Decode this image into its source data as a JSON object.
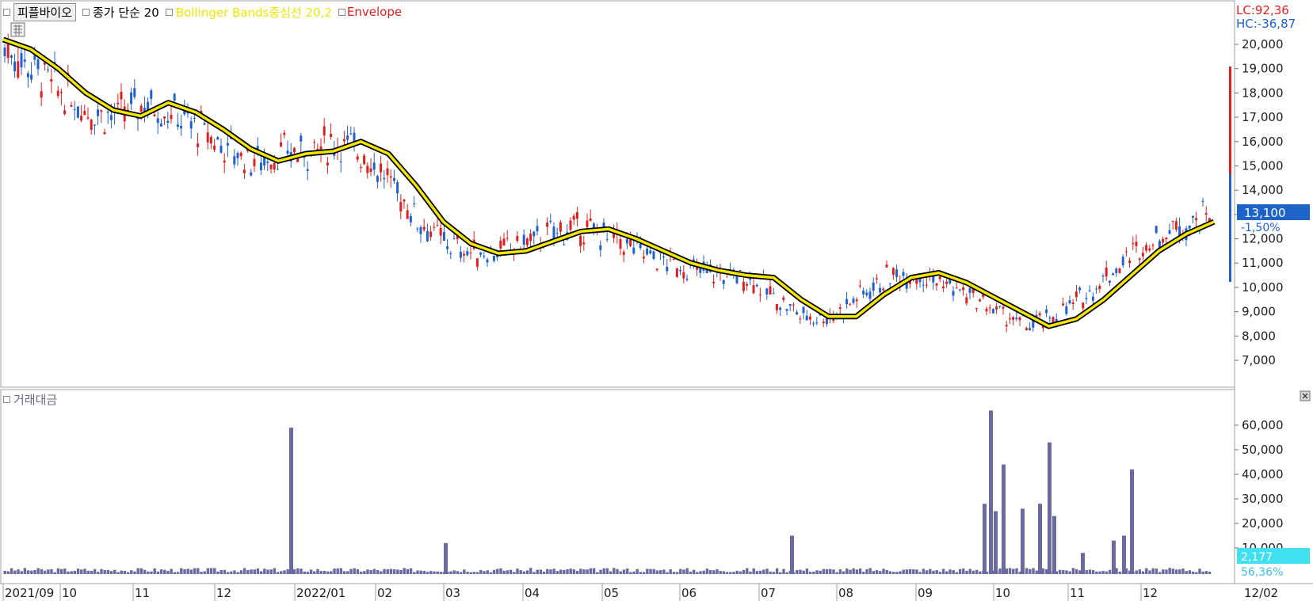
{
  "legend": {
    "stock_name": "피플바이오",
    "ma_label": "종가 단순 20",
    "bb_label": "Bollinger Bands중심선 20,2",
    "env_label": "Envelope"
  },
  "volume_title": "거래대금",
  "top_right": {
    "lc": "LC:92,36",
    "hc": "HC:-36,87"
  },
  "current": {
    "price": "13,100",
    "change": "-1,50%",
    "volume": "2,177",
    "volume_pct": "56,36%"
  },
  "colors": {
    "up": "#e02020",
    "down": "#2060d0",
    "ma": "#000000",
    "bb": "#f2e600",
    "volume": "#6a6aa0",
    "price_box": "#1e64c8",
    "volume_box": "#40e0f0"
  },
  "chart_data": [
    {
      "type": "candlestick",
      "title": "",
      "ylim": [
        6200,
        21200
      ],
      "y_ticks": [
        "7,000",
        "8,000",
        "9,000",
        "10,000",
        "11,000",
        "12,000",
        "13,000",
        "14,000",
        "15,000",
        "16,000",
        "17,000",
        "18,000",
        "19,000",
        "20,000"
      ],
      "x_ticks": [
        "2021/09",
        "10",
        "11",
        "12",
        "2022/01",
        "02",
        "03",
        "04",
        "05",
        "06",
        "07",
        "08",
        "09",
        "10",
        "11",
        "12",
        "12/02"
      ],
      "series": [
        {
          "name": "종가 단순 20",
          "values": [
            20200,
            19800,
            19000,
            18000,
            17300,
            17050,
            17600,
            17200,
            16500,
            15700,
            15200,
            15500,
            15600,
            16000,
            15500,
            14200,
            12700,
            11800,
            11400,
            11500,
            11900,
            12300,
            12400,
            12000,
            11500,
            11000,
            10700,
            10500,
            10400,
            9500,
            8800,
            8800,
            9700,
            10400,
            10600,
            10200,
            9600,
            9000,
            8400,
            8700,
            9500,
            10500,
            11500,
            12200,
            12700
          ]
        },
        {
          "name": "Bollinger Bands중심선 20,2",
          "values": [
            20200,
            19800,
            19000,
            18000,
            17300,
            17050,
            17600,
            17200,
            16500,
            15700,
            15200,
            15500,
            15600,
            16000,
            15500,
            14200,
            12700,
            11800,
            11400,
            11500,
            11900,
            12300,
            12400,
            12000,
            11500,
            11000,
            10700,
            10500,
            10400,
            9500,
            8800,
            8800,
            9700,
            10400,
            10600,
            10200,
            9600,
            9000,
            8400,
            8700,
            9500,
            10500,
            11500,
            12200,
            12700
          ]
        }
      ],
      "last_close": 13100
    },
    {
      "type": "bar",
      "title": "거래대금",
      "ylim": [
        0,
        70000
      ],
      "y_ticks": [
        "10,000",
        "20,000",
        "30,000",
        "40,000",
        "50,000",
        "60,000"
      ],
      "spikes": [
        {
          "x": 367,
          "value": 59000
        },
        {
          "x": 562,
          "value": 12000
        },
        {
          "x": 999,
          "value": 15000
        },
        {
          "x": 1242,
          "value": 28000
        },
        {
          "x": 1250,
          "value": 66000
        },
        {
          "x": 1256,
          "value": 25000
        },
        {
          "x": 1266,
          "value": 44000
        },
        {
          "x": 1290,
          "value": 26000
        },
        {
          "x": 1312,
          "value": 28000
        },
        {
          "x": 1324,
          "value": 53000
        },
        {
          "x": 1330,
          "value": 23000
        },
        {
          "x": 1366,
          "value": 8000
        },
        {
          "x": 1405,
          "value": 13000
        },
        {
          "x": 1418,
          "value": 15000
        },
        {
          "x": 1428,
          "value": 42000
        }
      ],
      "baseline_value": 1500
    }
  ]
}
